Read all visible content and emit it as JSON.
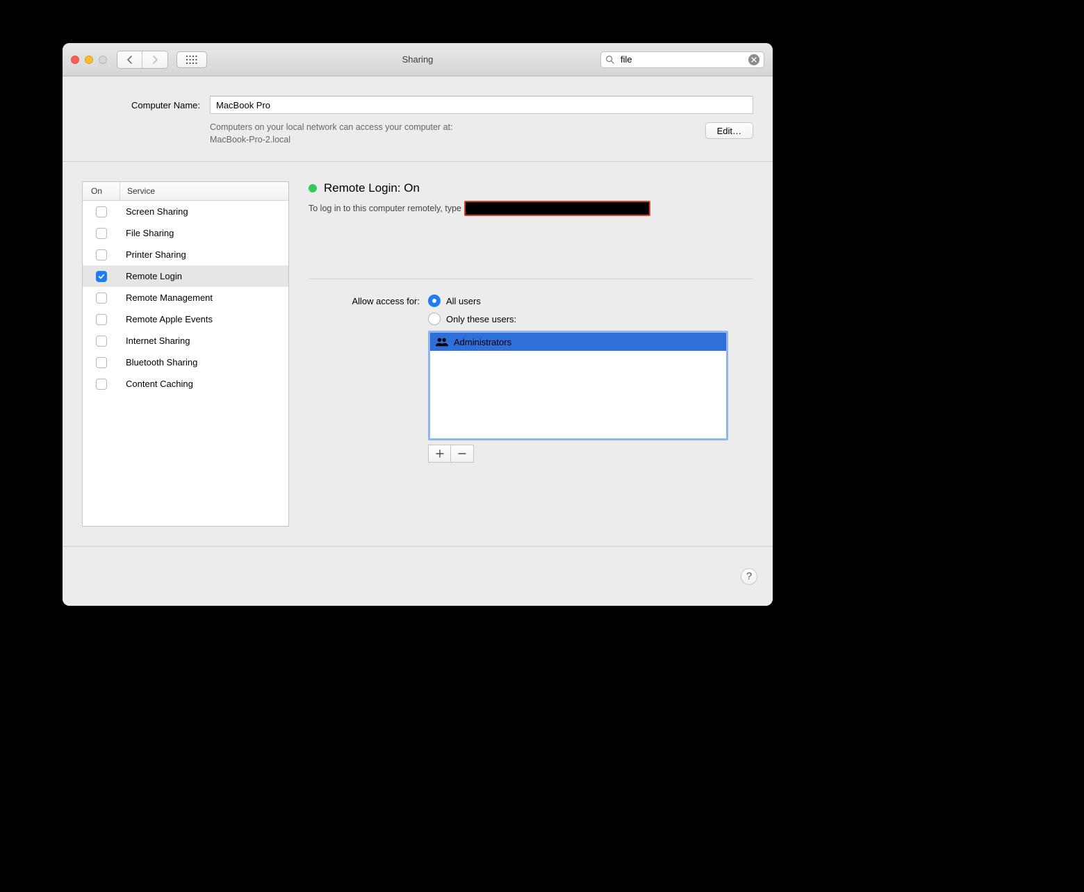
{
  "window": {
    "title": "Sharing"
  },
  "search": {
    "value": "file"
  },
  "computer_name": {
    "label": "Computer Name:",
    "value": "MacBook Pro",
    "description_line1": "Computers on your local network can access your computer at:",
    "description_line2": "MacBook-Pro-2.local",
    "edit_label": "Edit…"
  },
  "services": {
    "col_on": "On",
    "col_service": "Service",
    "items": [
      {
        "name": "Screen Sharing",
        "on": false,
        "selected": false
      },
      {
        "name": "File Sharing",
        "on": false,
        "selected": false
      },
      {
        "name": "Printer Sharing",
        "on": false,
        "selected": false
      },
      {
        "name": "Remote Login",
        "on": true,
        "selected": true
      },
      {
        "name": "Remote Management",
        "on": false,
        "selected": false
      },
      {
        "name": "Remote Apple Events",
        "on": false,
        "selected": false
      },
      {
        "name": "Internet Sharing",
        "on": false,
        "selected": false
      },
      {
        "name": "Bluetooth Sharing",
        "on": false,
        "selected": false
      },
      {
        "name": "Content Caching",
        "on": false,
        "selected": false
      }
    ]
  },
  "detail": {
    "status_title": "Remote Login: On",
    "status_desc_prefix": "To log in to this computer remotely, type",
    "access_label": "Allow access for:",
    "radio_all": "All users",
    "radio_only": "Only these users:",
    "selected_radio": "all",
    "users": [
      {
        "name": "Administrators",
        "selected": true
      }
    ]
  }
}
